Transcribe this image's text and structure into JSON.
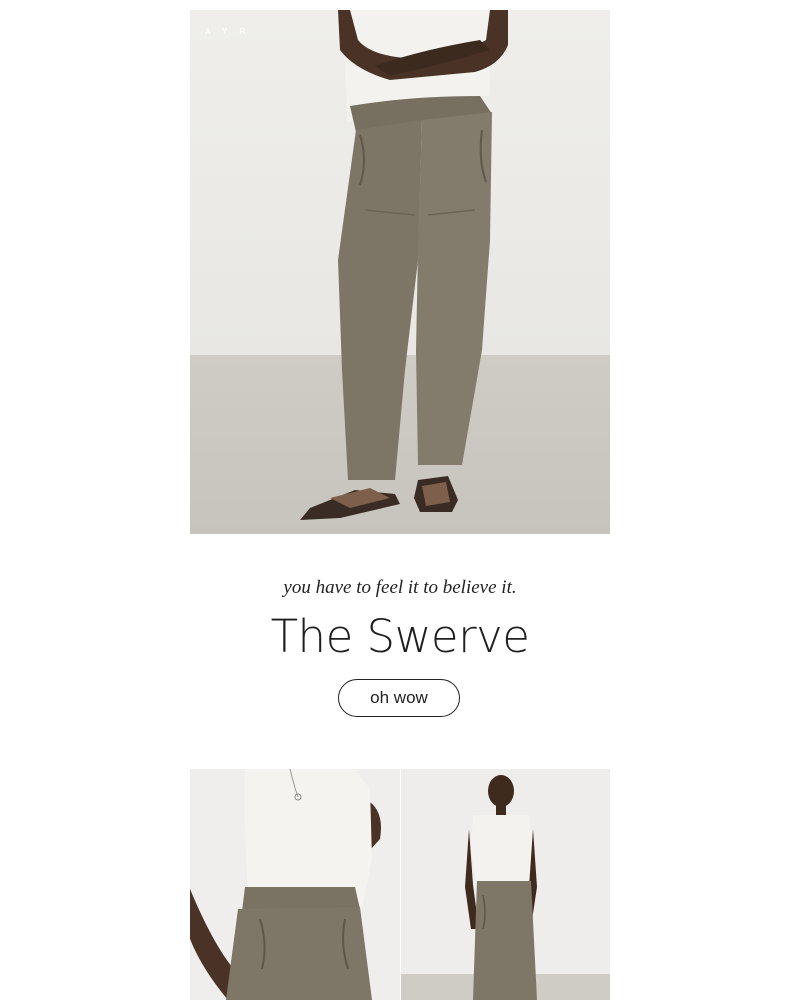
{
  "brand": {
    "logo_text": "AYR"
  },
  "hero": {
    "image_alt": "model wearing olive pull-on pants with flip flops"
  },
  "headline": {
    "tagline": "you have to feel it to believe it.",
    "title": "The Swerve"
  },
  "cta": {
    "label": "oh wow"
  },
  "gallery": [
    {
      "image_alt": "close-up of olive pants and white tee"
    },
    {
      "image_alt": "full-length model in white tee and olive pants"
    }
  ],
  "colors": {
    "pants": "#7d7667",
    "shirt": "#f3f2ee",
    "skin": "#4a3326",
    "wall": "#efeeeb",
    "floor": "#cbc7c1",
    "text": "#1f1f1f"
  }
}
